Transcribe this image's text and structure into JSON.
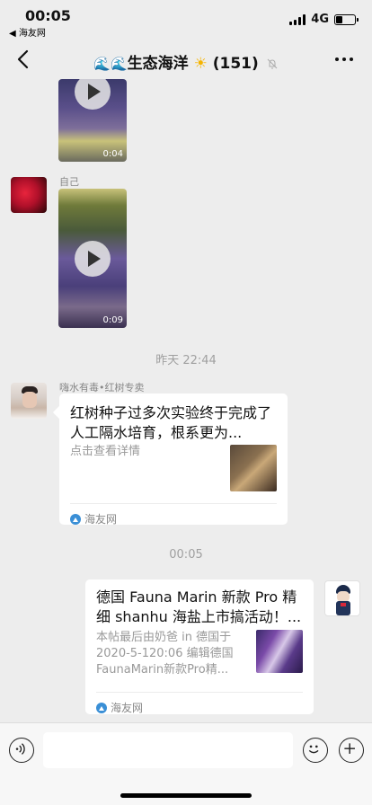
{
  "status": {
    "time": "00:05",
    "back_app": "◀ 海友网",
    "network": "4G",
    "battery_level": 0.35
  },
  "nav": {
    "title_prefix": "🌊🌊",
    "title_text": "生态海洋",
    "title_sun": "☀",
    "member_count": "(151)"
  },
  "messages": {
    "video1": {
      "duration": "0:04"
    },
    "self_name": "自己",
    "video2": {
      "duration": "0:09"
    },
    "timestamp1": "昨天 22:44",
    "sender_name": "嗨水有毒•红树专卖",
    "card1": {
      "title": "红树种子过多次实验终于完成了人工隔水培育，根系更为...",
      "desc": "点击查看详情",
      "source": "海友网"
    },
    "timestamp2": "00:05",
    "card2": {
      "title": "德国 Fauna Marin 新款 Pro 精细 shanhu 海盐上市搞活动！...",
      "desc": "本帖最后由奶爸 in 德国于 2020-5-120:06 编辑德国 FaunaMarin新款Pro精...",
      "source": "海友网"
    }
  },
  "input": {
    "placeholder": ""
  },
  "colors": {
    "background": "#ededed",
    "card": "#ffffff",
    "muted_text": "#a0a0a0",
    "source_icon": "#3a8fd6"
  },
  "icons": [
    "back-chevron-icon",
    "mute-bell-icon",
    "more-icon",
    "play-icon",
    "voice-icon",
    "emoji-icon",
    "plus-icon",
    "source-logo-icon"
  ]
}
